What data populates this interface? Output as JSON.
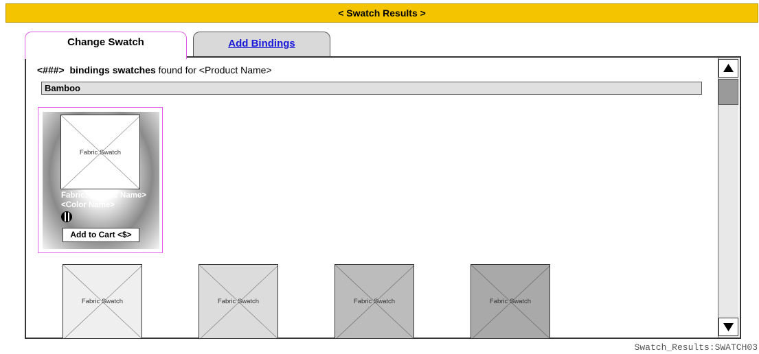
{
  "window": {
    "title": "< Swatch Results >"
  },
  "tabs": [
    {
      "label": "Change Swatch",
      "active": true
    },
    {
      "label": "Add Bindings",
      "active": false
    }
  ],
  "results": {
    "count": "<###>",
    "type": "bindings swatches",
    "suffix": "found for <Product Name>"
  },
  "group": {
    "label": "Bamboo"
  },
  "selected_swatch": {
    "image_label": "Fabric Swatch",
    "fabric_line": "Fabric: <Fabric Name>",
    "color_line": "<Color Name>",
    "icon": "pattern-icon",
    "button_label": "Add to Cart <$>"
  },
  "swatches": [
    {
      "label": "Fabric Swatch",
      "fill": "#efefef"
    },
    {
      "label": "Fabric Swatch",
      "fill": "#dcdcdc"
    },
    {
      "label": "Fabric Swatch",
      "fill": "#bcbcbc"
    },
    {
      "label": "Fabric Swatch",
      "fill": "#a9a9a9"
    }
  ],
  "scrollbar": {
    "up_icon": "scroll-up-arrow-icon",
    "down_icon": "scroll-down-arrow-icon"
  },
  "footer": {
    "id": "Swatch_Results:SWATCH03"
  },
  "colors": {
    "title_bar": "#f5c400",
    "selection_border": "#e05ce6",
    "link": "#1a1adb"
  }
}
